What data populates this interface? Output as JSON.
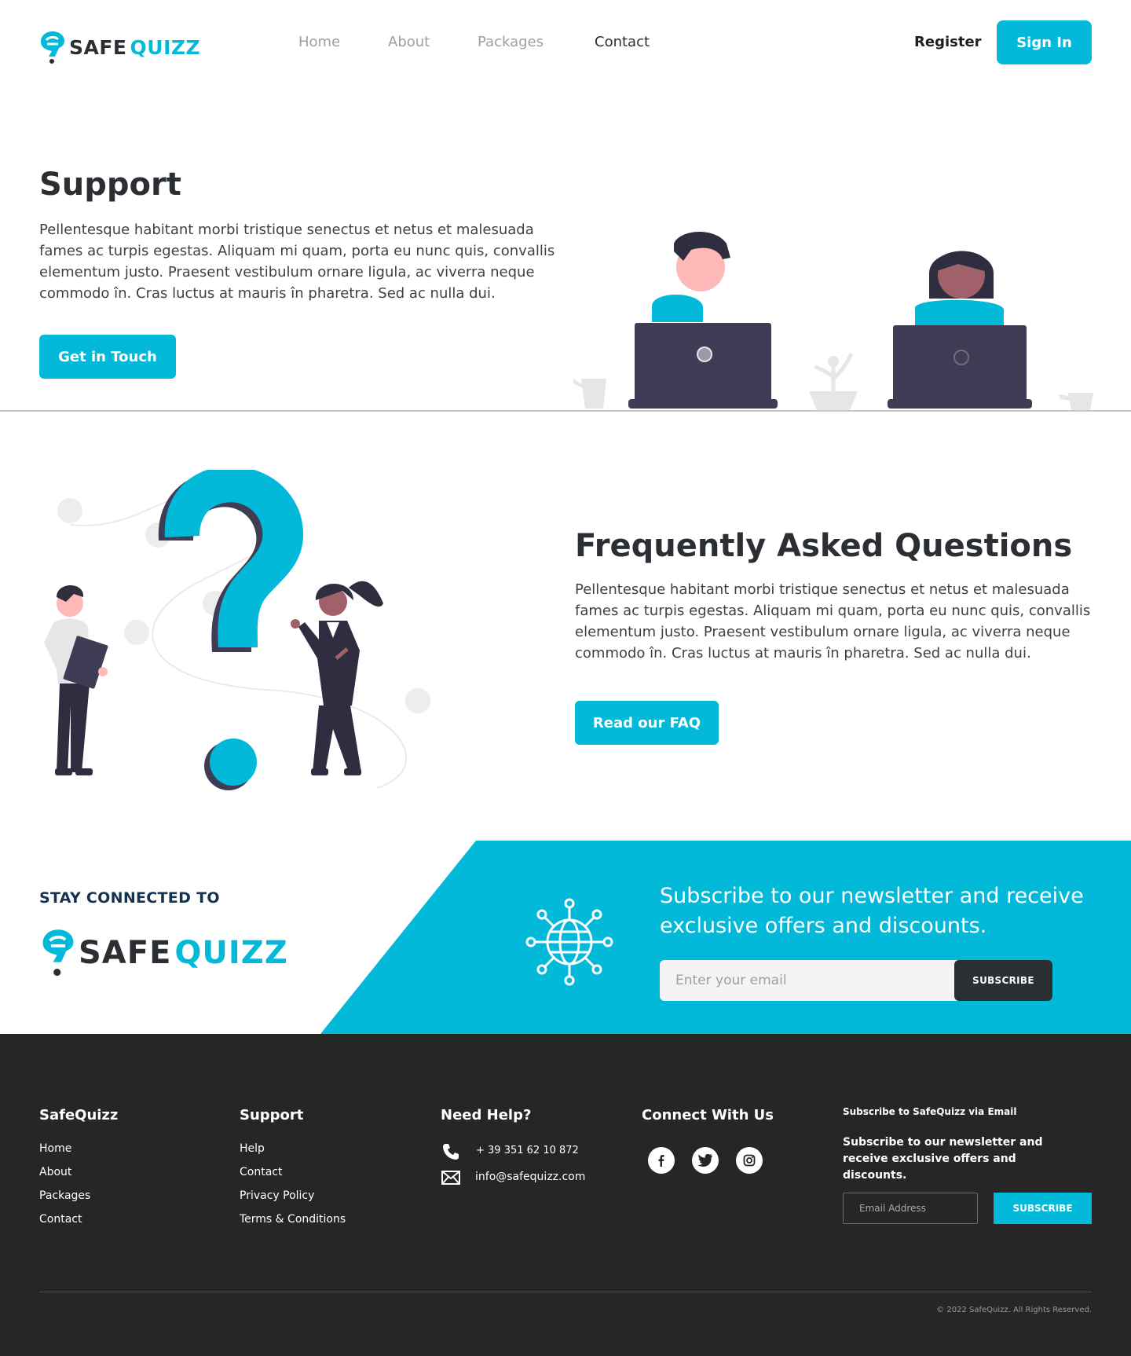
{
  "brand": {
    "name_part1": "SAFE",
    "name_part2": "QUIZZ",
    "accent": "#03b9da",
    "dark": "#2b2f33"
  },
  "nav": {
    "items": [
      {
        "label": "Home"
      },
      {
        "label": "About"
      },
      {
        "label": "Packages"
      },
      {
        "label": "Contact"
      }
    ],
    "register": "Register",
    "sign_in": "Sign In"
  },
  "support": {
    "title": "Support",
    "text": "Pellentesque habitant morbi tristique senectus et netus et malesuada fames ac turpis egestas. Aliquam mi quam, porta eu nunc quis, convallis elementum justo. Praesent vestibulum ornare ligula, ac viverra neque commodo în. Cras luctus at mauris în pharetra. Sed ac nulla dui.",
    "button": "Get in Touch"
  },
  "faq": {
    "title": "Frequently Asked Questions",
    "text": "Pellentesque habitant morbi tristique senectus et netus et malesuada fames ac turpis egestas. Aliquam mi quam, porta eu nunc quis, convallis elementum justo. Praesent vestibulum ornare ligula, ac viverra neque commodo în. Cras luctus at mauris în pharetra. Sed ac nulla dui.",
    "button": "Read our FAQ"
  },
  "newsletter": {
    "stay": "STAY CONNECTED TO",
    "heading": "Subscribe to our newsletter and receive exclusive offers and discounts.",
    "placeholder": "Enter your email",
    "button": "SUBSCRIBE"
  },
  "footer": {
    "col1": {
      "title": "SafeQuizz",
      "links": [
        "Home",
        "About",
        "Packages",
        "Contact"
      ]
    },
    "col2": {
      "title": "Support",
      "links": [
        "Help",
        "Contact",
        "Privacy Policy",
        "Terms & Conditions"
      ]
    },
    "col3": {
      "title": "Need Help?",
      "phone": "+ 39 351 62 10 872",
      "email": "info@safequizz.com"
    },
    "col4": {
      "title": "Connect With Us",
      "icons": [
        "facebook-icon",
        "twitter-icon",
        "instagram-icon"
      ]
    },
    "col5": {
      "title": "Subscribe to SafeQuizz via Email",
      "text": "Subscribe to our newsletter and receive exclusive offers and discounts.",
      "placeholder": "Email Address",
      "button": "SUBSCRIBE"
    },
    "copyright": "© 2022 SafeQuizz. All Rights Reserved."
  }
}
